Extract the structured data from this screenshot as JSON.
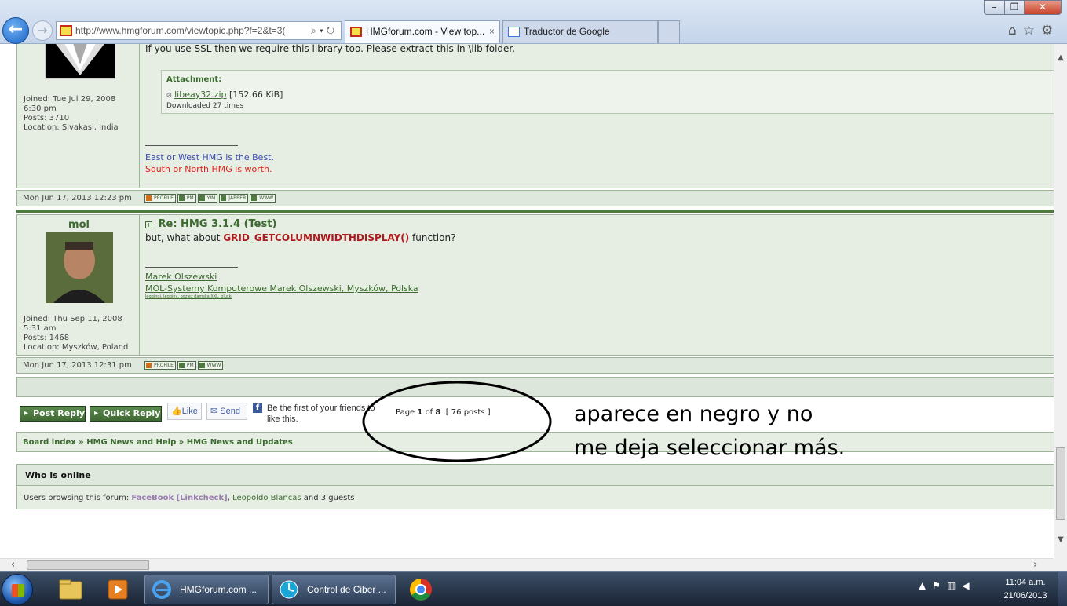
{
  "browser": {
    "address_url": "http://www.hmgforum.com/viewtopic.php?f=2&t=3(",
    "tabs": [
      {
        "label": "HMGforum.com - View top...",
        "close": "×"
      },
      {
        "label": "Traductor de Google"
      }
    ]
  },
  "post1": {
    "profile": {
      "joined": "Joined: Tue Jul 29, 2008",
      "joined_time": "6:30 pm",
      "posts": "Posts: 3710",
      "location": "Location: Sivakasi, India"
    },
    "text_line": "If you use SSL then we require this library too. Please extract this in \\lib folder.",
    "attachment": {
      "header": "Attachment:",
      "file_name": "libeay32.zip",
      "file_size": "[152.66 KiB]",
      "downloads": "Downloaded 27 times"
    },
    "signature": {
      "line1": "East or West HMG is the Best.",
      "line2": "South or North HMG is worth."
    },
    "footer": {
      "date": "Mon Jun 17, 2013 12:23 pm",
      "buttons": [
        "PROFILE",
        "PM",
        "YIM",
        "JABBER",
        "WWW"
      ]
    }
  },
  "post2": {
    "profile": {
      "username": "mol",
      "joined": "Joined: Thu Sep 11, 2008",
      "joined_time": "5:31 am",
      "posts": "Posts: 1468",
      "location": "Location: Myszków, Poland"
    },
    "title": "Re: HMG 3.1.4 (Test)",
    "body_before": "but, what about",
    "body_highlight": "GRID_GETCOLUMNWIDTHDISPLAY()",
    "body_after": "function?",
    "signature": {
      "line1": "Marek Olszewski",
      "line2": "MOL-Systemy Komputerowe Marek Olszewski, Myszków, Polska",
      "line3": "leggingi, legginy, odzież damska XXL, bluski"
    },
    "footer": {
      "date": "Mon Jun 17, 2013 12:31 pm",
      "buttons": [
        "PROFILE",
        "PM",
        "WWW"
      ]
    }
  },
  "actions": {
    "post_reply": "Post Reply",
    "quick_reply": "Quick Reply",
    "like": "Like",
    "send": "Send",
    "fb_text_1": "Be the first of your friends to",
    "fb_text_2": "like this.",
    "pagination_page": "Page",
    "pagination_current": "1",
    "pagination_of": "of",
    "pagination_total": "8",
    "pagination_posts": "[ 76 posts ]"
  },
  "breadcrumb": {
    "items": [
      "Board index",
      "HMG News and Help",
      "HMG News and Updates"
    ],
    "separator": "»"
  },
  "who_is_online": {
    "title": "Who is online",
    "prefix": "Users browsing this forum:",
    "user1": "FaceBook [Linkcheck]",
    "user2": "Leopoldo Blancas",
    "suffix": "and 3 guests"
  },
  "annotation": {
    "line1": "aparece en negro y no",
    "line2": "me deja seleccionar más."
  },
  "taskbar": {
    "tasks": [
      {
        "label": "HMGforum.com ..."
      },
      {
        "label": "Control de Ciber ..."
      }
    ],
    "clock_time": "11:04 a.m.",
    "clock_date": "21/06/2013"
  },
  "colors": {
    "forum_green": "#4e7a3f",
    "post_bg": "#e6eee4",
    "highlight_red": "#b0191c",
    "sig_blue": "#3b4bb0",
    "sig_red": "#e0201a"
  }
}
